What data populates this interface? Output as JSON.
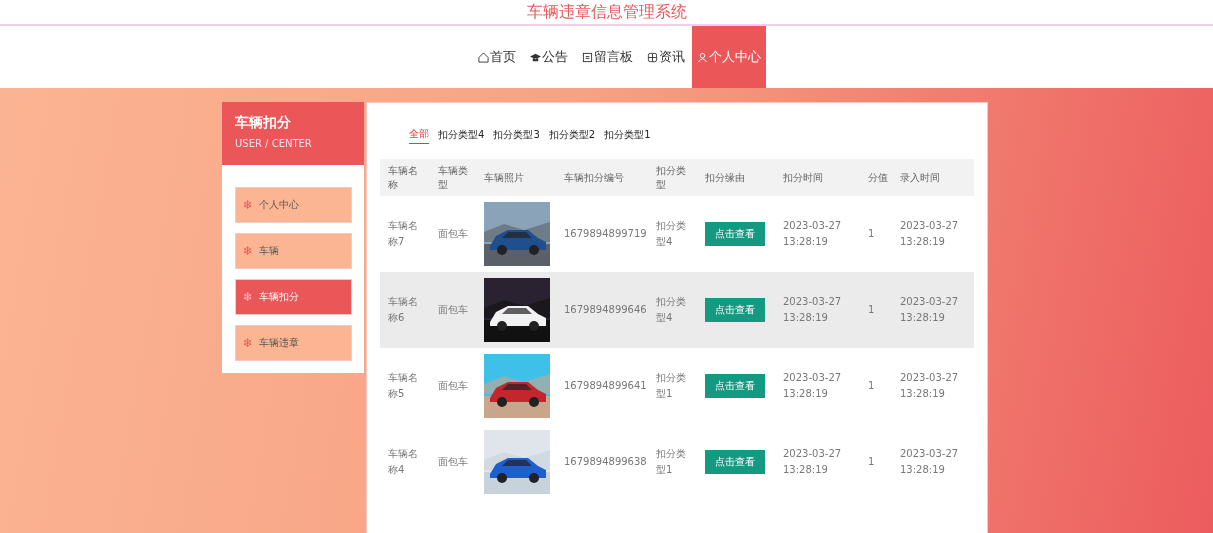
{
  "site_title": "车辆违章信息管理系统",
  "nav": [
    {
      "label": "首页",
      "selected": false
    },
    {
      "label": "公告",
      "selected": false
    },
    {
      "label": "留言板",
      "selected": false
    },
    {
      "label": "资讯",
      "selected": false
    },
    {
      "label": "个人中心",
      "selected": true
    }
  ],
  "sidebar": {
    "title": "车辆扣分",
    "subtitle": "USER / CENTER",
    "items": [
      {
        "icon": "❄",
        "label": "个人中心",
        "selected": false
      },
      {
        "icon": "❄",
        "label": "车辆",
        "selected": false
      },
      {
        "icon": "❄",
        "label": "车辆扣分",
        "selected": true
      },
      {
        "icon": "❄",
        "label": "车辆违章",
        "selected": false
      }
    ]
  },
  "filters": [
    {
      "label": "全部",
      "selected": true
    },
    {
      "label": "扣分类型4",
      "selected": false
    },
    {
      "label": "扣分类型3",
      "selected": false
    },
    {
      "label": "扣分类型2",
      "selected": false
    },
    {
      "label": "扣分类型1",
      "selected": false
    }
  ],
  "table": {
    "columns": [
      "车辆名称",
      "车辆类型",
      "车辆照片",
      "车辆扣分编号",
      "扣分类型",
      "扣分缘由",
      "扣分时间",
      "分值",
      "录入时间"
    ],
    "rows": [
      {
        "name": "车辆名称7",
        "type": "面包车",
        "number": "1679894899719",
        "deduct_type": "扣分类型4",
        "button": "点击查看",
        "time": "2023-03-27 13:28:19",
        "score": "1",
        "entry_time": "2023-03-27 13:28:19",
        "selected": false
      },
      {
        "name": "车辆名称6",
        "type": "面包车",
        "number": "1679894899646",
        "deduct_type": "扣分类型4",
        "button": "点击查看",
        "time": "2023-03-27 13:28:19",
        "score": "1",
        "entry_time": "2023-03-27 13:28:19",
        "selected": true
      },
      {
        "name": "车辆名称5",
        "type": "面包车",
        "number": "1679894899641",
        "deduct_type": "扣分类型1",
        "button": "点击查看",
        "time": "2023-03-27 13:28:19",
        "score": "1",
        "entry_time": "2023-03-27 13:28:19",
        "selected": false
      },
      {
        "name": "车辆名称4",
        "type": "面包车",
        "number": "1679894899638",
        "deduct_type": "扣分类型1",
        "button": "点击查看",
        "time": "2023-03-27 13:28:19",
        "score": "1",
        "entry_time": "2023-03-27 13:28:19",
        "selected": false
      }
    ]
  }
}
